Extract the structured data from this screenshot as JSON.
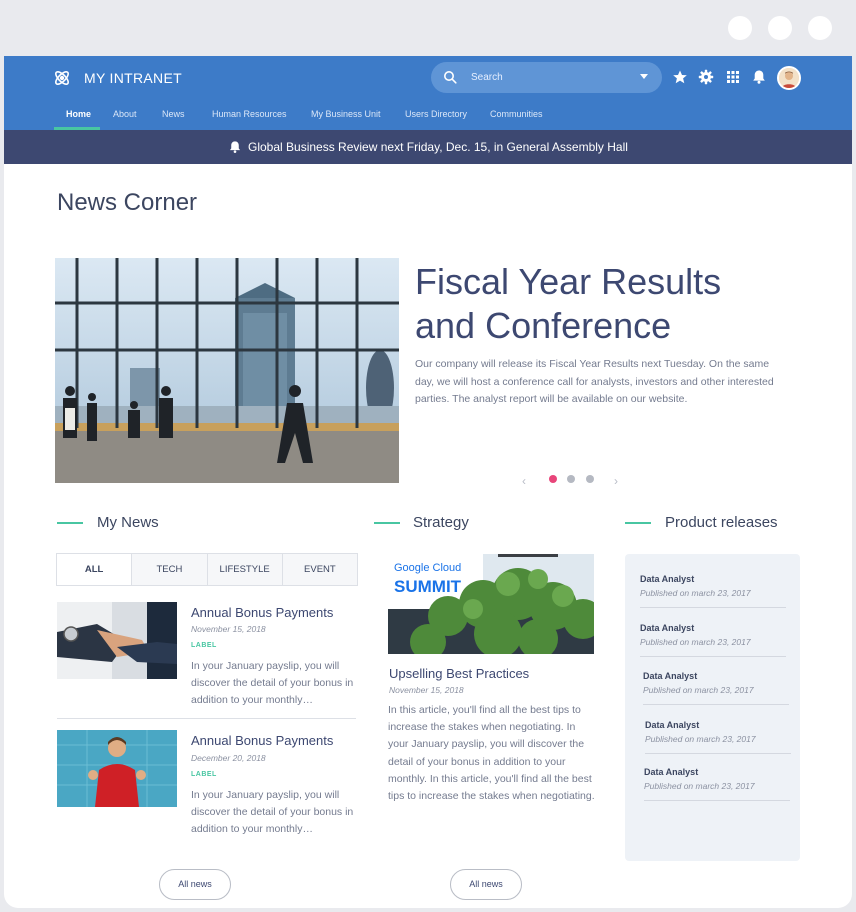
{
  "app": {
    "title": "MY INTRANET"
  },
  "search": {
    "placeholder": "Search"
  },
  "header_icons": [
    "star-icon",
    "gear-icon",
    "apps-grid-icon",
    "bell-icon"
  ],
  "nav": [
    {
      "label": "Home",
      "active": true
    },
    {
      "label": "About"
    },
    {
      "label": "News"
    },
    {
      "label": "Human Resources"
    },
    {
      "label": "My Business Unit"
    },
    {
      "label": "Users Directory"
    },
    {
      "label": "Communities"
    }
  ],
  "banner": {
    "text": "Global Business Review next Friday, Dec. 15, in General Assembly Hall"
  },
  "page": {
    "title": "News Corner"
  },
  "hero": {
    "title_line1": "Fiscal Year Results",
    "title_line2": "and Conference",
    "text": "Our company will release its Fiscal Year Results next Tuesday. On the same day, we will host a conference call for analysts, investors and other interested parties. The analyst report will be available on our website.",
    "slides": 3,
    "active_slide": 1
  },
  "my_news": {
    "heading": "My News",
    "tabs": [
      "ALL",
      "TECH",
      "LIFESTYLE",
      "EVENT"
    ],
    "items": [
      {
        "title": "Annual Bonus Payments",
        "date": "November 15, 2018",
        "label": "LABEL",
        "excerpt": "In your January payslip, you will discover the detail of your bonus in addition to your monthly…"
      },
      {
        "title": "Annual Bonus Payments",
        "date": "December 20, 2018",
        "label": "LABEL",
        "excerpt": "In your January payslip, you will discover the detail of your bonus in addition to your monthly…"
      }
    ],
    "button": "All news"
  },
  "strategy": {
    "heading": "Strategy",
    "image_text_1": "Google Cloud",
    "image_text_2": "SUMMIT",
    "title": "Upselling Best Practices",
    "date": "November 15, 2018",
    "text": "In this article, you'll find all the best tips to increase the stakes when negotiating. In your January payslip, you will discover the detail of your bonus in addition to your monthly. In this article, you'll find all the best tips to increase the stakes when negotiating.",
    "button": "All news"
  },
  "product_releases": {
    "heading": "Product releases",
    "items": [
      {
        "title": "Data Analyst",
        "date": "Published on march 23, 2017"
      },
      {
        "title": "Data Analyst",
        "date": "Published on march 23, 2017"
      },
      {
        "title": "Data Analyst",
        "date": "Published on march 23, 2017"
      },
      {
        "title": "Data Analyst",
        "date": "Published on march 23, 2017"
      },
      {
        "title": "Data Analyst",
        "date": "Published on march 23, 2017"
      }
    ]
  },
  "colors": {
    "header": "#3d7bc8",
    "banner": "#3d4871",
    "accent": "#48c6a2",
    "active_dot": "#e8457a"
  }
}
